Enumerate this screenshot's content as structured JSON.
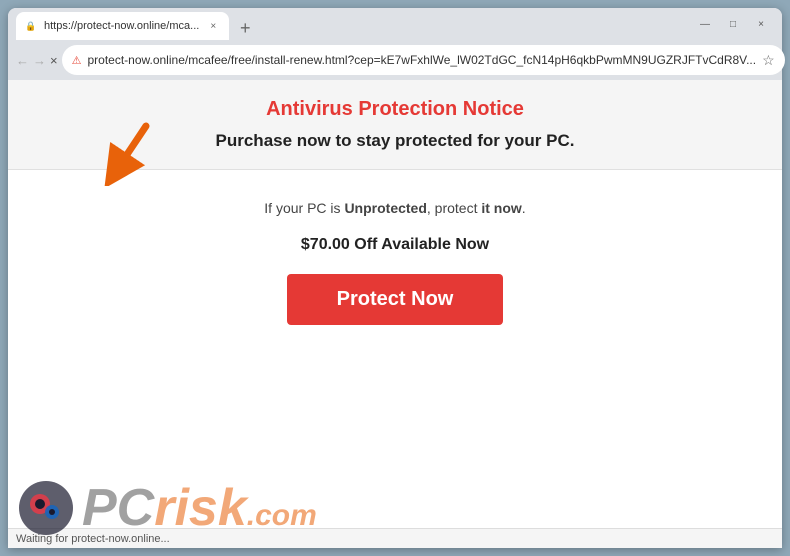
{
  "browser": {
    "tab": {
      "favicon": "🔒",
      "title": "https://protect-now.online/mca...",
      "close_label": "×"
    },
    "new_tab_label": "+",
    "window_controls": {
      "minimize": "—",
      "maximize": "□",
      "close": "×"
    },
    "toolbar": {
      "back_label": "←",
      "forward_label": "→",
      "close_label": "×",
      "refresh_label": "↻",
      "security_icon": "⚠",
      "url": "protect-now.online/mcafee/free/install-renew.html?cep=kE7wFxhlWe_lW02TdGC_fcN14pH6qkbPwmMN9UGZRJFTvCdR8V...",
      "bookmark_label": "☆",
      "profile_label": "●",
      "menu_label": "⋮"
    },
    "status_bar": {
      "text": "Waiting for protect-now.online..."
    }
  },
  "page": {
    "notice_title": "Antivirus Protection Notice",
    "notice_subtitle": "Purchase now to stay protected for your PC.",
    "unprotected_line": {
      "before": "If your PC is ",
      "bold": "Unprotected",
      "after": ", protect ",
      "bold2": "it now",
      "end": "."
    },
    "discount_text": "$70.00 Off Available Now",
    "protect_button": "Protect Now"
  },
  "watermark": {
    "pc_text": "PC",
    "risk_text": "risk",
    "domain": ".com"
  }
}
